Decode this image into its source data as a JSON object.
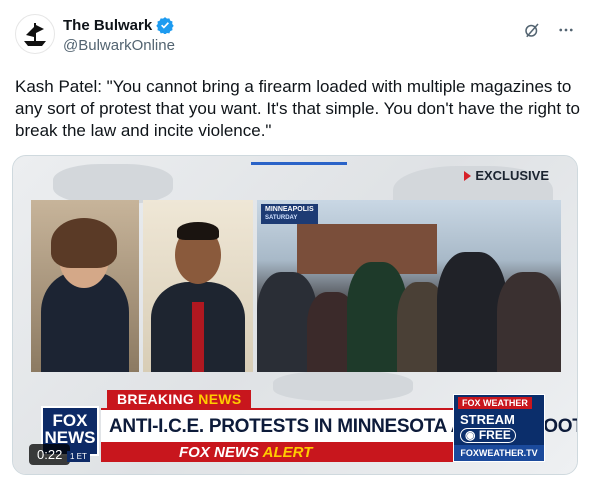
{
  "author": {
    "name": "The Bulwark",
    "handle": "@BulwarkOnline"
  },
  "icons": {
    "avatar": "ship-icon",
    "verified": "verified-badge-icon",
    "grok": "grok-icon",
    "more": "more-icon"
  },
  "tweet": {
    "text": "Kash Patel: \"You cannot bring a firearm loaded with multiple magazines to any sort of protest that you want. It's that simple. You don't have the right to break the law and incite violence.\""
  },
  "video": {
    "exclusive_label": "EXCLUSIVE",
    "location": "MINNEAPOLIS",
    "day": "SATURDAY",
    "breaking_prefix": "BREAKING",
    "breaking_suffix": "NEWS",
    "headline": "ANTI-I.C.E. PROTESTS IN MINNESOTA AFTER SHOOTING",
    "alert_prefix": "FOX NEWS",
    "alert_suffix": "ALERT",
    "channel_logo_line1": "FOX",
    "channel_logo_line2": "NEWS",
    "time_zone": "1 ET",
    "weather_brand": "FOX WEATHER",
    "stream_label": "STREAM",
    "free_label": "FREE",
    "weather_url": "FOXWEATHER.TV",
    "timestamp": "0:22"
  },
  "colors": {
    "fox_red": "#c8161d",
    "fox_navy": "#0d2a66",
    "verified_blue": "#1d9bf0"
  }
}
